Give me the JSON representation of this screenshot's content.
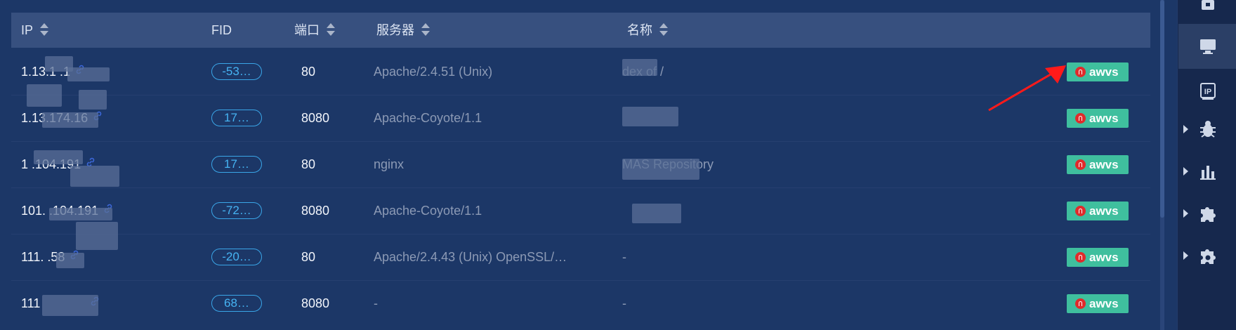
{
  "table": {
    "headers": {
      "ip": "IP",
      "fid": "FID",
      "port": "端口",
      "server": "服务器",
      "name": "名称"
    },
    "rows": [
      {
        "ip": "1.13.1 .1",
        "fid": "-53…",
        "port": "80",
        "server": "Apache/2.4.51 (Unix)",
        "name": "dex of /",
        "action": "awvs"
      },
      {
        "ip": "1.13.174.16",
        "fid": "17…",
        "port": "8080",
        "server": "Apache-Coyote/1.1",
        "name": "",
        "action": "awvs"
      },
      {
        "ip": "1 .104.191",
        "fid": "17…",
        "port": "80",
        "server": "nginx",
        "name": "MAS Repository",
        "action": "awvs"
      },
      {
        "ip": "101. .104.191",
        "fid": "-72…",
        "port": "8080",
        "server": "Apache-Coyote/1.1",
        "name": "",
        "action": "awvs"
      },
      {
        "ip": "111. .58",
        "fid": "-20…",
        "port": "80",
        "server": "Apache/2.4.43 (Unix) OpenSSL/…",
        "name": "-",
        "action": "awvs"
      },
      {
        "ip": "111",
        "fid": "68…",
        "port": "8080",
        "server": "-",
        "name": "-",
        "action": "awvs"
      }
    ]
  },
  "sidebar": {
    "items": [
      {
        "icon": "lock-icon",
        "active": false
      },
      {
        "icon": "monitor-icon",
        "active": true
      },
      {
        "icon": "ip-icon",
        "label": "IP",
        "active": false
      },
      {
        "icon": "bug-icon",
        "active": false
      },
      {
        "icon": "bar-chart-icon",
        "active": false
      },
      {
        "icon": "puzzle-icon",
        "active": false
      },
      {
        "icon": "gear-puzzle-icon",
        "active": false
      }
    ]
  },
  "colors": {
    "background": "#1c3767",
    "header": "#37507f",
    "awvs_button": "#3fbf9e",
    "fid_pill": "#3aa6e8",
    "annotation_arrow": "#ff1a1a"
  }
}
